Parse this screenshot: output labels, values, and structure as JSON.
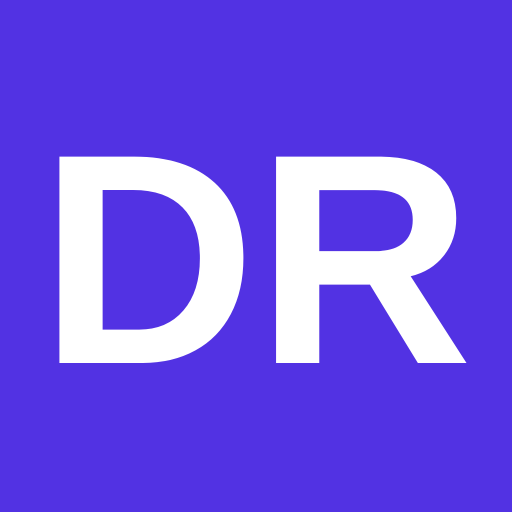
{
  "icon": {
    "text": "DR",
    "background_color": "#5232E3",
    "text_color": "#FFFFFF"
  }
}
